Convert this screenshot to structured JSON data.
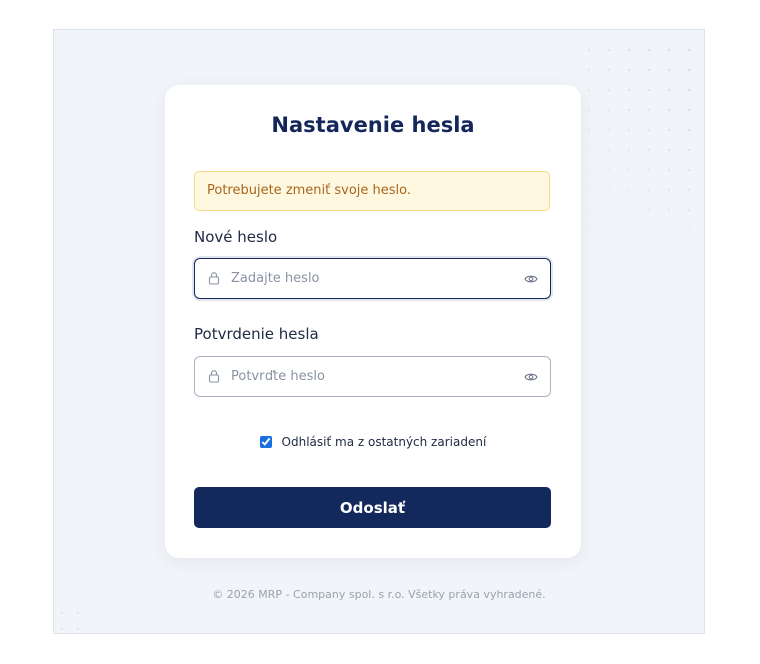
{
  "form": {
    "title": "Nastavenie hesla",
    "alert_text": "Potrebujete zmeniť svoje heslo.",
    "new_password": {
      "label": "Nové heslo",
      "placeholder": "Zadajte heslo",
      "value": ""
    },
    "confirm_password": {
      "label": "Potvrdenie hesla",
      "placeholder": "Potvrďte heslo",
      "value": ""
    },
    "logout_checkbox": {
      "label": "Odhlásiť ma z ostatných zariadení",
      "checked": true
    },
    "submit_label": "Odoslať"
  },
  "footer": {
    "copyright": "© 2026 MRP - Company spol. s r.o. Všetky práva vyhradené."
  },
  "icons": {
    "field_leading": "lock-icon",
    "field_trailing": "eye-icon"
  },
  "colors": {
    "primary": "#13285b",
    "alert_bg": "#fff8e1",
    "alert_border": "#f7d98a",
    "alert_text": "#a9661d",
    "background": "#f1f4f8"
  }
}
